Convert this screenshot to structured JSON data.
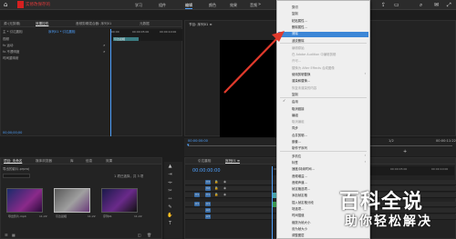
{
  "menubar": {
    "save_text": "实修改保存的",
    "items": [
      "学习",
      "组件",
      "编辑",
      "颜色",
      "效果",
      "音频",
      "图形",
      "库"
    ],
    "more": "»"
  },
  "source_panel": {
    "tabs": [
      "源:(无剪辑)",
      "效果控件",
      "音频剪辑混合器: 序列01",
      "元数据"
    ],
    "row_main": "主 * 引达晨相",
    "row_seq": "序列01 * 引达晨相",
    "col_header": "视频",
    "rows": [
      "fx  运动",
      "fx  不透明度",
      "   时间重映射"
    ],
    "timecodes": [
      "00:00",
      "00:00:05:00",
      "00:00:10:00"
    ],
    "clip_label": "引达晨相",
    "timecode": "00;00;00;00"
  },
  "program_monitor": {
    "title": "节目: 序列01 ≡",
    "timecode_left": "00:00:00:00",
    "timecode_right": "00:00:11:22",
    "fit": "1/2"
  },
  "project_panel": {
    "tabs": [
      "项目: 未命名",
      "媒体浏览器",
      "库",
      "信息",
      "效果"
    ],
    "file": "导出的影片.prproj",
    "count": "1 项已选择，共 3 项",
    "thumbs": [
      {
        "label": "导出影片.mp4",
        "dur": "11;22"
      },
      {
        "label": "引达晨相",
        "dur": "11;22"
      },
      {
        "label": "序列01",
        "dur": "11;22"
      }
    ]
  },
  "timeline_panel": {
    "tabs": [
      "引达晨相",
      "序列01 ≡"
    ],
    "timecode": "00:00:00:00",
    "ruler": [
      "00:00:00",
      "00:00:05:00",
      "00:00:10:00"
    ],
    "tracks_v": [
      "V3",
      "V2",
      "V1"
    ],
    "tracks_a": [
      "A1",
      "A2",
      "A3"
    ]
  },
  "context_menu": {
    "items": [
      {
        "label": "剪切",
        "dis": false
      },
      {
        "label": "复制",
        "dis": false
      },
      {
        "label": "粘贴属性...",
        "dis": false
      },
      {
        "label": "删除属性...",
        "dis": false
      },
      {
        "label": "清除",
        "dis": false
      },
      {
        "label": "波纹删除",
        "dis": false
      },
      {
        "label": "编辑原始",
        "dis": true
      },
      {
        "label": "在 Adobe Audition 中编辑剪辑",
        "dis": true
      },
      {
        "label": "许可...",
        "dis": true
      },
      {
        "label": "替换为 After Effects 合成图像",
        "dis": true
      },
      {
        "label": "使用剪辑替换",
        "dis": false
      },
      {
        "label": "渲染和替换...",
        "dis": false
      },
      {
        "label": "恢复未渲染的内容",
        "dis": true
      },
      {
        "label": "复制",
        "dis": false
      },
      {
        "label": "启用",
        "dis": false
      },
      {
        "label": "取消链接",
        "dis": false
      },
      {
        "label": "编组",
        "dis": false
      },
      {
        "label": "取消编组",
        "dis": true
      },
      {
        "label": "同步",
        "dis": false
      },
      {
        "label": "合并剪辑...",
        "dis": false
      },
      {
        "label": "嵌套...",
        "dis": false
      },
      {
        "label": "制作子序列",
        "dis": false
      },
      {
        "label": "多机位",
        "dis": false
      },
      {
        "label": "标签",
        "dis": false
      },
      {
        "label": "速度/持续时间...",
        "dis": false
      },
      {
        "label": "音频增益...",
        "dis": false
      },
      {
        "label": "音频声道...",
        "dis": false
      },
      {
        "label": "帧定格选项...",
        "dis": false
      },
      {
        "label": "添加帧定格",
        "dis": false
      },
      {
        "label": "插入帧定格分段",
        "dis": false
      },
      {
        "label": "场选项...",
        "dis": false
      },
      {
        "label": "时间插值",
        "dis": false
      },
      {
        "label": "缩放为帧大小",
        "dis": false
      },
      {
        "label": "设为帧大小",
        "dis": false
      },
      {
        "label": "调整图层",
        "dis": false
      }
    ],
    "checked": "启用"
  },
  "watermark": {
    "line1": "百科全说",
    "line2": "助你轻松解决"
  },
  "colors": {
    "accent": "#4ea1ff",
    "highlight": "#3c86d6",
    "clip": "#3b7c82",
    "arrow": "#e03a2c"
  }
}
